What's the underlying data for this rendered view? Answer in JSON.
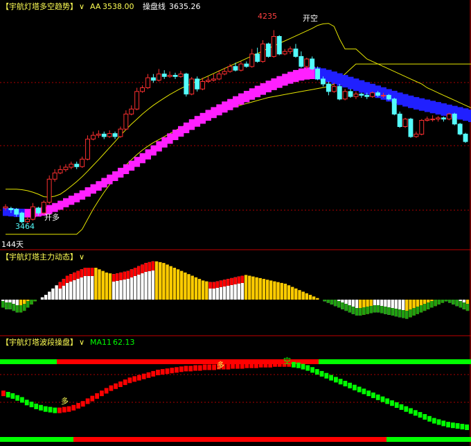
{
  "panel1": {
    "title": "【宇航灯塔多空趋势】",
    "aa_label": "AA",
    "aa_value": "3538.00",
    "line_label": "操盘线",
    "line_value": "3635.26",
    "high_label": "4235",
    "low_label": "3464",
    "open_long": "开多",
    "open_short": "开空",
    "days": "144天"
  },
  "panel2": {
    "title": "【宇航灯塔主力动态】"
  },
  "panel3": {
    "title": "【宇航灯塔波段操盘】",
    "ma_label": "MA11",
    "ma_value": "62.13",
    "long_marker": "多",
    "short_marker": "空"
  },
  "colors": {
    "background": "#000000",
    "up_candle": "#ff3030",
    "down_candle": "#54fcfc",
    "trend_up": "#ff20ff",
    "trend_down": "#2020ff",
    "channel": "#e6e600",
    "title": "#ffff54",
    "bar_red": "#ff0000",
    "bar_white": "#ffffff",
    "bar_yellow": "#ffcc00",
    "bar_green": "#1fa010",
    "band_green": "#00ff00",
    "band_red": "#ff0000"
  },
  "chart_data": [
    {
      "type": "candlestick",
      "title": "【宇航灯塔多空趋势】",
      "ylim": [
        3400,
        4300
      ],
      "candles": [
        [
          3525,
          3530,
          3515,
          3540
        ],
        [
          3523,
          3518,
          3505,
          3530
        ],
        [
          3520,
          3500,
          3490,
          3525
        ],
        [
          3505,
          3470,
          3464,
          3510
        ],
        [
          3470,
          3480,
          3465,
          3490
        ],
        [
          3480,
          3530,
          3475,
          3545
        ],
        [
          3525,
          3505,
          3495,
          3530
        ],
        [
          3505,
          3548,
          3500,
          3555
        ],
        [
          3548,
          3640,
          3540,
          3655
        ],
        [
          3640,
          3665,
          3630,
          3680
        ],
        [
          3665,
          3678,
          3660,
          3695
        ],
        [
          3678,
          3688,
          3670,
          3700
        ],
        [
          3688,
          3700,
          3680,
          3710
        ],
        [
          3700,
          3690,
          3680,
          3710
        ],
        [
          3690,
          3720,
          3685,
          3730
        ],
        [
          3720,
          3800,
          3715,
          3815
        ],
        [
          3800,
          3815,
          3795,
          3830
        ],
        [
          3815,
          3820,
          3805,
          3835
        ],
        [
          3820,
          3810,
          3800,
          3830
        ],
        [
          3810,
          3822,
          3805,
          3835
        ],
        [
          3822,
          3810,
          3800,
          3830
        ],
        [
          3810,
          3840,
          3805,
          3850
        ],
        [
          3840,
          3900,
          3835,
          3915
        ],
        [
          3900,
          3920,
          3895,
          3935
        ],
        [
          3920,
          3990,
          3915,
          4005
        ],
        [
          3990,
          4005,
          3985,
          4015
        ],
        [
          4005,
          4045,
          4000,
          4060
        ],
        [
          4045,
          4035,
          4025,
          4060
        ],
        [
          4035,
          4060,
          4030,
          4080
        ],
        [
          4060,
          4050,
          4040,
          4075
        ],
        [
          4050,
          4055,
          4045,
          4070
        ],
        [
          4055,
          4050,
          4040,
          4065
        ],
        [
          4050,
          4060,
          4045,
          4072
        ],
        [
          4060,
          3980,
          3970,
          4065
        ],
        [
          3980,
          4040,
          3975,
          4048
        ],
        [
          4040,
          4000,
          3990,
          4050
        ],
        [
          4000,
          4030,
          3995,
          4045
        ],
        [
          4030,
          4035,
          4025,
          4050
        ],
        [
          4035,
          4040,
          4030,
          4060
        ],
        [
          4040,
          4060,
          4035,
          4075
        ],
        [
          4060,
          4070,
          4055,
          4085
        ],
        [
          4070,
          4090,
          4065,
          4100
        ],
        [
          4090,
          4075,
          4070,
          4105
        ],
        [
          4075,
          4100,
          4070,
          4110
        ],
        [
          4100,
          4090,
          4085,
          4110
        ],
        [
          4090,
          4140,
          4085,
          4160
        ],
        [
          4140,
          4110,
          4105,
          4165
        ],
        [
          4110,
          4180,
          4105,
          4195
        ],
        [
          4180,
          4130,
          4125,
          4185
        ],
        [
          4130,
          4210,
          4125,
          4235
        ],
        [
          4210,
          4140,
          4135,
          4215
        ],
        [
          4140,
          4150,
          4135,
          4160
        ],
        [
          4150,
          4160,
          4140,
          4170
        ],
        [
          4160,
          4130,
          4125,
          4180
        ],
        [
          4130,
          4090,
          4085,
          4150
        ],
        [
          4090,
          4120,
          4080,
          4125
        ],
        [
          4120,
          4080,
          4075,
          4130
        ],
        [
          4080,
          4040,
          4035,
          4090
        ],
        [
          4040,
          4020,
          4010,
          4050
        ],
        [
          4020,
          3990,
          3975,
          4030
        ],
        [
          3990,
          4010,
          3985,
          4025
        ],
        [
          4010,
          3960,
          3955,
          4020
        ],
        [
          3960,
          3990,
          3955,
          4000
        ],
        [
          3990,
          3970,
          3965,
          4000
        ],
        [
          3970,
          3980,
          3960,
          3990
        ],
        [
          3980,
          3975,
          3965,
          3985
        ],
        [
          3975,
          3970,
          3960,
          3985
        ],
        [
          3970,
          3985,
          3965,
          3990
        ],
        [
          3985,
          3975,
          3968,
          3992
        ],
        [
          3975,
          3975,
          3965,
          3985
        ],
        [
          3975,
          3960,
          3955,
          3980
        ],
        [
          3960,
          3900,
          3895,
          3965
        ],
        [
          3900,
          3850,
          3845,
          3910
        ],
        [
          3850,
          3880,
          3845,
          3885
        ],
        [
          3880,
          3810,
          3805,
          3885
        ],
        [
          3810,
          3820,
          3805,
          3830
        ],
        [
          3820,
          3875,
          3815,
          3880
        ],
        [
          3875,
          3880,
          3870,
          3890
        ],
        [
          3880,
          3880,
          3870,
          3895
        ],
        [
          3880,
          3885,
          3870,
          3892
        ],
        [
          3885,
          3880,
          3870,
          3890
        ],
        [
          3880,
          3900,
          3875,
          3905
        ],
        [
          3900,
          3860,
          3855,
          3905
        ],
        [
          3860,
          3820,
          3815,
          3865
        ],
        [
          3820,
          3790,
          3785,
          3825
        ]
      ],
      "trend": [
        3510,
        3508,
        3506,
        3505,
        3504,
        3505,
        3508,
        3512,
        3519,
        3527,
        3536,
        3546,
        3556,
        3566,
        3577,
        3589,
        3601,
        3613,
        3626,
        3639,
        3652,
        3666,
        3680,
        3694,
        3709,
        3724,
        3739,
        3755,
        3771,
        3787,
        3802,
        3817,
        3831,
        3845,
        3858,
        3871,
        3883,
        3895,
        3906,
        3917,
        3928,
        3938,
        3949,
        3960,
        3970,
        3980,
        3990,
        4000,
        4010,
        4019,
        4028,
        4037,
        4045,
        4052,
        4058,
        4062,
        4064,
        4062,
        4058,
        4052,
        4045,
        4038,
        4031,
        4024,
        4017,
        4010,
        4003,
        3996,
        3989,
        3982,
        3975,
        3968,
        3961,
        3955,
        3949,
        3943,
        3938,
        3933,
        3928,
        3923,
        3918,
        3913,
        3908,
        3903,
        3898,
        3893
      ],
      "channel_upper": [
        3600,
        3600,
        3600,
        3598,
        3594,
        3588,
        3580,
        3570,
        3568,
        3572,
        3580,
        3595,
        3612,
        3630,
        3650,
        3672,
        3695,
        3718,
        3742,
        3766,
        3790,
        3815,
        3838,
        3860,
        3880,
        3900,
        3918,
        3935,
        3950,
        3964,
        3978,
        3990,
        4002,
        4012,
        4022,
        4032,
        4042,
        4052,
        4062,
        4072,
        4082,
        4092,
        4102,
        4112,
        4122,
        4132,
        4142,
        4152,
        4162,
        4172,
        4182,
        4192,
        4202,
        4212,
        4222,
        4232,
        4242,
        4254,
        4260,
        4262,
        4250,
        4200,
        4160,
        4160,
        4160,
        4140,
        4120,
        4110,
        4100,
        4090,
        4080,
        4070,
        4060,
        4050,
        4040,
        4030,
        4020,
        4005,
        3995,
        3985,
        3975,
        3965,
        3955,
        3945,
        3935,
        3925
      ],
      "channel_lower": [
        3420,
        3420,
        3420,
        3420,
        3420,
        3420,
        3420,
        3420,
        3420,
        3420,
        3420,
        3420,
        3420,
        3420,
        3440,
        3480,
        3520,
        3555,
        3588,
        3618,
        3646,
        3672,
        3696,
        3718,
        3738,
        3756,
        3772,
        3786,
        3798,
        3810,
        3822,
        3834,
        3846,
        3858,
        3870,
        3880,
        3890,
        3898,
        3906,
        3912,
        3918,
        3924,
        3930,
        3936,
        3942,
        3948,
        3954,
        3960,
        3966,
        3970,
        3974,
        3978,
        3982,
        3986,
        3990,
        3994,
        3998,
        4002,
        4006,
        4010,
        4020,
        4040,
        4060,
        4080,
        4100,
        4100,
        4100,
        4100,
        4100,
        4100,
        4100,
        4100,
        4100,
        4100,
        4100,
        4100,
        4100,
        4100,
        4100,
        4100,
        4100,
        4100,
        4100,
        4100,
        4100,
        4100
      ]
    },
    {
      "type": "bar",
      "title": "【宇航灯塔主力动态】",
      "ylim": [
        -30,
        50
      ],
      "values": [
        -10,
        -12,
        -12,
        -14,
        -16,
        -16,
        -14,
        -10,
        -6,
        -2,
        0,
        3,
        6,
        10,
        14,
        18,
        22,
        26,
        30,
        32,
        34,
        36,
        38,
        40,
        40,
        40,
        40,
        38,
        36,
        34,
        33,
        32,
        33,
        34,
        35,
        36,
        38,
        40,
        42,
        44,
        46,
        47,
        48,
        48,
        47,
        46,
        44,
        42,
        40,
        38,
        36,
        34,
        32,
        30,
        28,
        26,
        24,
        23,
        22,
        22,
        23,
        24,
        25,
        26,
        27,
        28,
        29,
        30,
        31,
        30,
        29,
        28,
        27,
        26,
        25,
        24,
        23,
        22,
        21,
        20,
        18,
        16,
        14,
        12,
        10,
        8,
        6,
        4,
        2,
        0,
        -2,
        -4,
        -6,
        -8,
        -10,
        -12,
        -14,
        -16,
        -18,
        -20,
        -20,
        -19,
        -18,
        -17,
        -16,
        -16,
        -17,
        -18,
        -19,
        -20,
        -21,
        -22,
        -23,
        -24,
        -22,
        -20,
        -18,
        -16,
        -14,
        -12,
        -10,
        -8,
        -6,
        -4,
        -2,
        -4,
        -6,
        -8,
        -10,
        -12,
        -14
      ]
    },
    {
      "type": "line",
      "title": "【宇航灯塔波段操盘】",
      "ylim": [
        0,
        100
      ],
      "values": [
        52,
        50,
        48,
        45,
        42,
        38,
        35,
        32,
        30,
        28,
        27,
        26,
        26,
        27,
        28,
        30,
        33,
        36,
        40,
        44,
        48,
        52,
        56,
        60,
        63,
        66,
        69,
        72,
        74,
        76,
        78,
        80,
        82,
        84,
        85,
        86,
        87,
        88,
        89,
        90,
        90,
        91,
        91,
        92,
        92,
        92,
        93,
        93,
        93,
        94,
        94,
        94,
        95,
        95,
        95,
        96,
        96,
        96,
        97,
        97,
        97,
        97,
        96,
        95,
        93,
        91,
        88,
        85,
        82,
        79,
        76,
        73,
        70,
        67,
        64,
        61,
        58,
        55,
        52,
        49,
        46,
        43,
        40,
        37,
        34,
        31,
        28,
        25,
        22,
        19,
        16,
        13,
        10,
        8,
        6,
        4,
        3,
        2,
        1,
        0
      ]
    }
  ]
}
